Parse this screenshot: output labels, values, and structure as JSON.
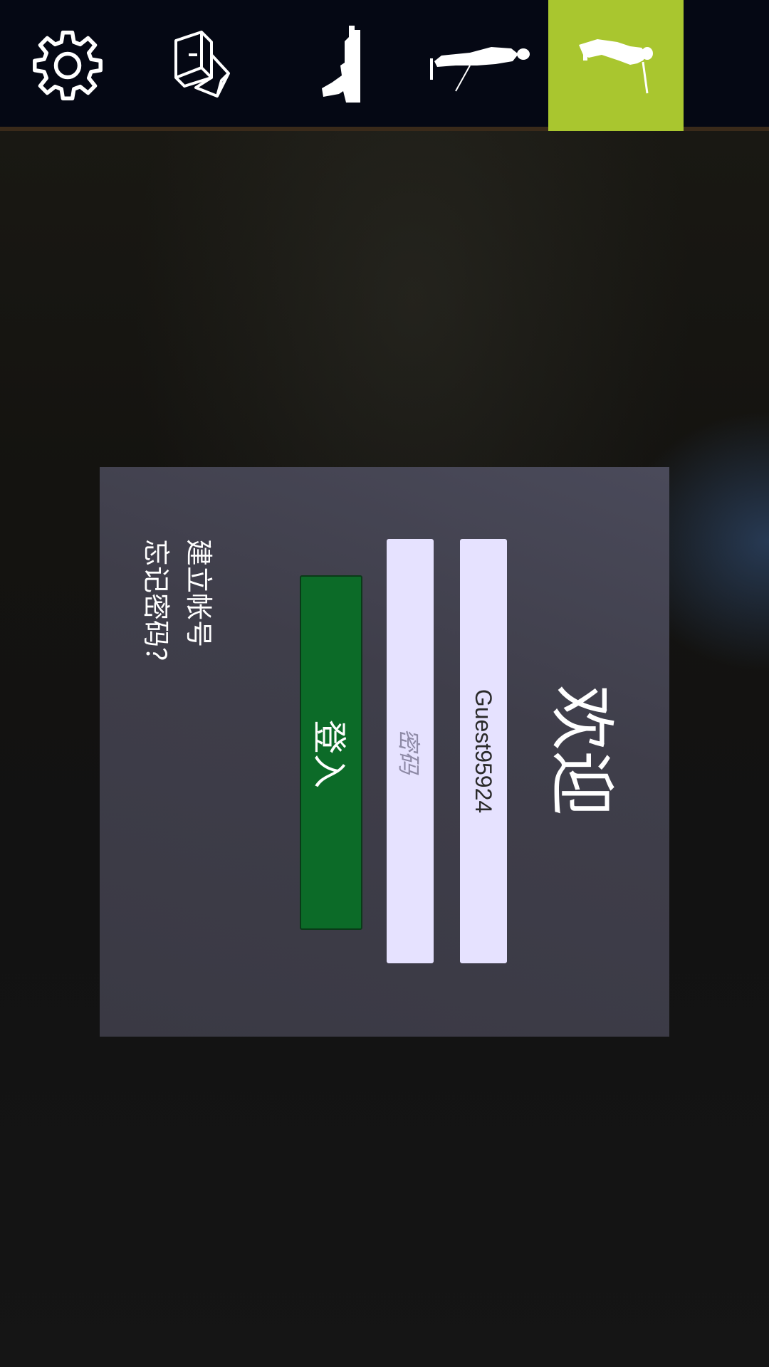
{
  "topbar": {
    "tabs": [
      {
        "icon": "gear-icon",
        "label": "settings"
      },
      {
        "icon": "cubes-icon",
        "label": "blocks"
      },
      {
        "icon": "pistol-icon",
        "label": "weapon"
      },
      {
        "icon": "soldier-prone-icon",
        "label": "character"
      },
      {
        "icon": "soldier-standing-icon",
        "label": "character-active"
      }
    ],
    "active_color": "#a9c62f",
    "bar_color": "#050814"
  },
  "login": {
    "title": "欢迎",
    "username_value": "Guest95924",
    "password_placeholder": "密码",
    "login_label": "登入",
    "create_account": "建立帐号",
    "forgot_password": "忘记密码？",
    "button_color": "#0c6b28",
    "field_color": "#e6e2ff"
  }
}
